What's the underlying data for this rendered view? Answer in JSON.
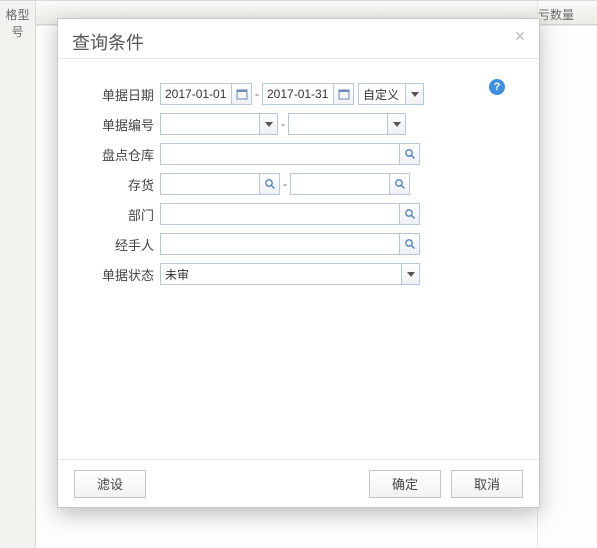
{
  "background": {
    "left_col_header": "格型号",
    "right_col_header": "亏数量"
  },
  "modal": {
    "title": "查询条件",
    "help_tooltip": "?",
    "labels": {
      "bill_date": "单据日期",
      "bill_no": "单据编号",
      "warehouse": "盘点仓库",
      "inventory": "存货",
      "department": "部门",
      "handler": "经手人",
      "status": "单据状态"
    },
    "values": {
      "date_from": "2017-01-01",
      "date_to": "2017-01-31",
      "date_preset": "自定义",
      "bill_no_from": "",
      "bill_no_to": "",
      "warehouse": "",
      "inventory_from": "",
      "inventory_to": "",
      "department": "",
      "handler": "",
      "status": "未审"
    },
    "buttons": {
      "filter": "滤设",
      "ok": "确定",
      "cancel": "取消"
    },
    "range_sep": "-"
  }
}
